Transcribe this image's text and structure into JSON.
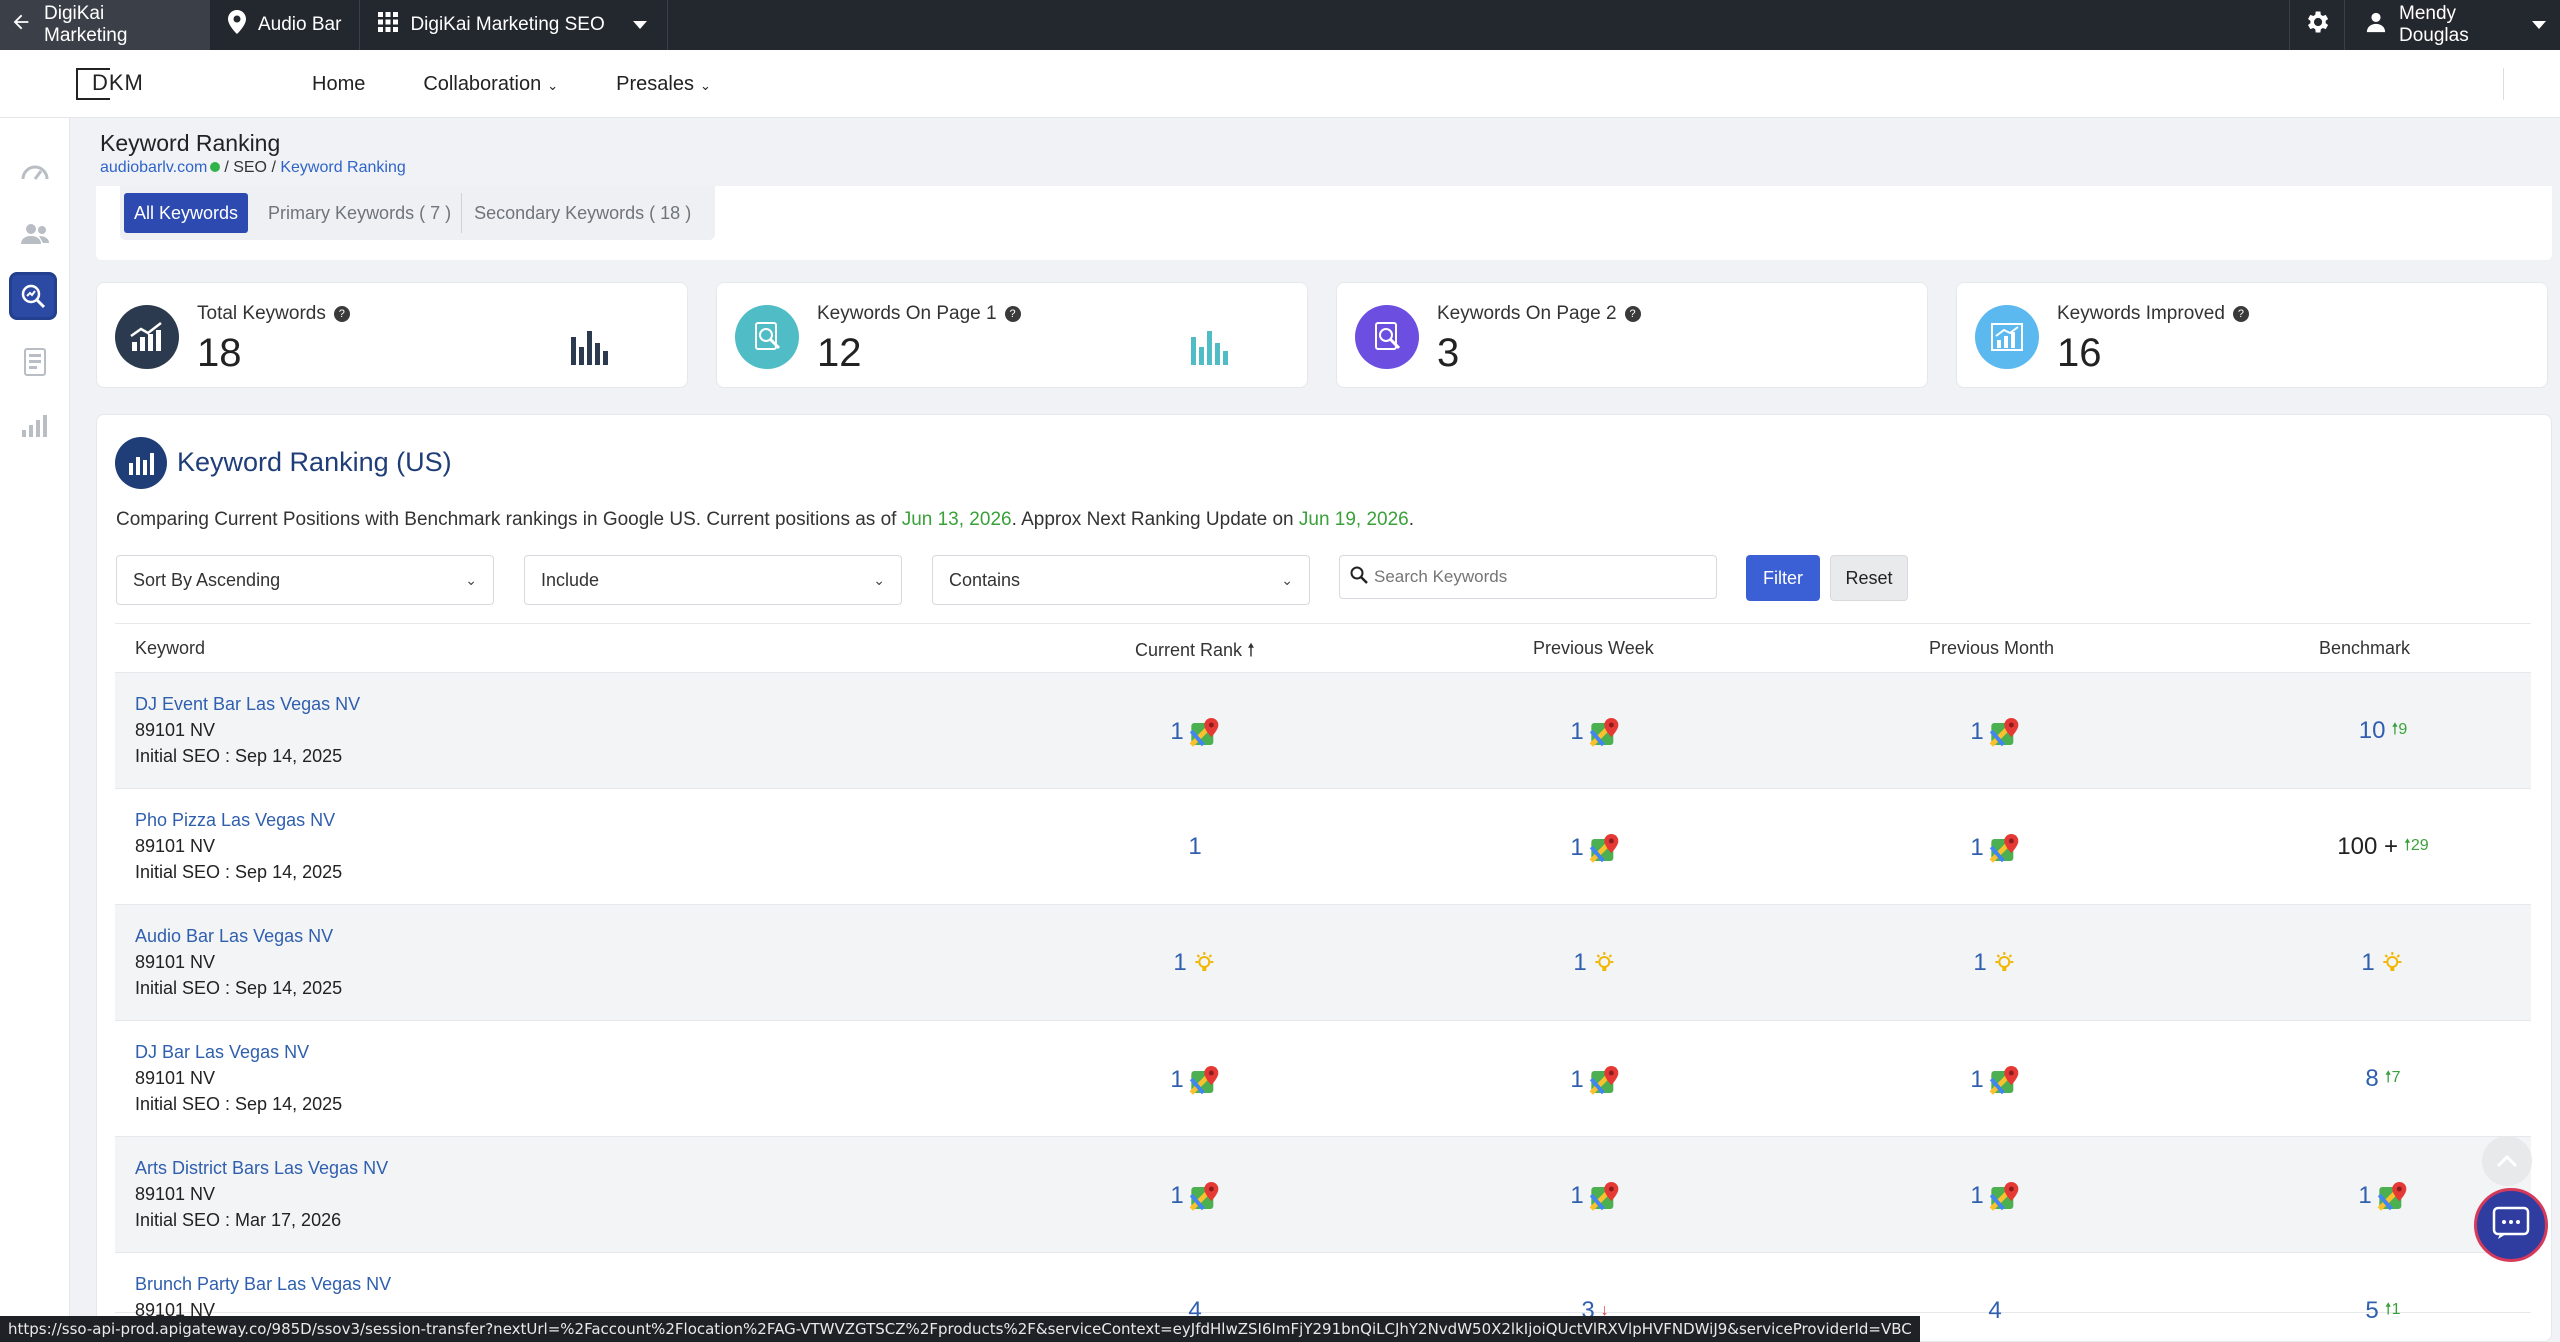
{
  "topbar": {
    "back_label": "DigiKai Marketing",
    "location": "Audio Bar",
    "app_switcher": "DigiKai Marketing SEO",
    "user_name": "Mendy Douglas"
  },
  "navbar": {
    "logo": "DKM",
    "links": [
      "Home",
      "Collaboration",
      "Presales"
    ]
  },
  "page": {
    "title": "Keyword Ranking",
    "breadcrumb": {
      "site": "audiobarlv.com",
      "section": "SEO",
      "current": "Keyword Ranking"
    }
  },
  "tabs": [
    "All Keywords",
    "Primary Keywords ( 7 )",
    "Secondary Keywords ( 18 )"
  ],
  "stats": [
    {
      "label": "Total Keywords",
      "value": "18",
      "color": "#2b3a4e"
    },
    {
      "label": "Keywords On Page 1",
      "value": "12",
      "color": "#4fbcc6"
    },
    {
      "label": "Keywords On Page 2",
      "value": "3",
      "color": "#6c4ee0"
    },
    {
      "label": "Keywords Improved",
      "value": "16",
      "color": "#5bb9f0"
    }
  ],
  "ranking": {
    "title": "Keyword Ranking (US)",
    "desc_prefix": "Comparing Current Positions with Benchmark rankings in Google US. Current positions as of ",
    "current_date": "Jun 13, 2026",
    "desc_mid": ". Approx Next Ranking Update on ",
    "next_date": "Jun 19, 2026",
    "desc_end": ".",
    "sort_select": "Sort By Ascending",
    "include_select": "Include",
    "contains_select": "Contains",
    "search_placeholder": "Search Keywords",
    "filter_label": "Filter",
    "reset_label": "Reset",
    "columns": [
      "Keyword",
      "Current Rank",
      "Previous Week",
      "Previous Month",
      "Benchmark"
    ],
    "sort_arrow": "🠕"
  },
  "rows": [
    {
      "keyword": "DJ Event Bar Las Vegas NV",
      "zip": "89101 NV",
      "initial": "Initial SEO : Sep 14, 2025",
      "current": "1",
      "current_icon": "map",
      "week": "1",
      "week_icon": "map",
      "month": "1",
      "month_icon": "map",
      "bench": "10",
      "bench_icon": "",
      "bench_change": "9",
      "bench_dir": "up",
      "bench_dark": false
    },
    {
      "keyword": "Pho Pizza Las Vegas NV",
      "zip": "89101 NV",
      "initial": "Initial SEO : Sep 14, 2025",
      "current": "1",
      "current_icon": "",
      "week": "1",
      "week_icon": "map",
      "month": "1",
      "month_icon": "map",
      "bench": "100 +",
      "bench_icon": "",
      "bench_change": "29",
      "bench_dir": "up",
      "bench_dark": true
    },
    {
      "keyword": "Audio Bar Las Vegas NV",
      "zip": "89101 NV",
      "initial": "Initial SEO : Sep 14, 2025",
      "current": "1",
      "current_icon": "bulb",
      "week": "1",
      "week_icon": "bulb",
      "month": "1",
      "month_icon": "bulb",
      "bench": "1",
      "bench_icon": "bulb",
      "bench_change": "",
      "bench_dir": "",
      "bench_dark": false
    },
    {
      "keyword": "DJ Bar Las Vegas NV",
      "zip": "89101 NV",
      "initial": "Initial SEO : Sep 14, 2025",
      "current": "1",
      "current_icon": "map",
      "week": "1",
      "week_icon": "map",
      "month": "1",
      "month_icon": "map",
      "bench": "8",
      "bench_icon": "",
      "bench_change": "7",
      "bench_dir": "up",
      "bench_dark": false
    },
    {
      "keyword": "Arts District Bars Las Vegas NV",
      "zip": "89101 NV",
      "initial": "Initial SEO : Mar 17, 2026",
      "current": "1",
      "current_icon": "map",
      "week": "1",
      "week_icon": "map",
      "month": "1",
      "month_icon": "map",
      "bench": "1",
      "bench_icon": "map",
      "bench_change": "",
      "bench_dir": "",
      "bench_dark": false
    },
    {
      "keyword": "Brunch Party Bar Las Vegas NV",
      "zip": "89101 NV",
      "initial": "",
      "current": "4",
      "current_icon": "",
      "week": "3",
      "week_icon": "",
      "week_change": "",
      "week_dir": "down",
      "month": "4",
      "month_icon": "",
      "bench": "5",
      "bench_icon": "",
      "bench_change": "1",
      "bench_dir": "up",
      "bench_dark": false
    }
  ],
  "status_url": "https://sso-api-prod.apigateway.co/985D/ssov3/session-transfer?nextUrl=%2Faccount%2Flocation%2FAG-VTWVZGTSCZ%2Fproducts%2F&serviceContext=eyJfdHlwZSI6ImFjY291bnQiLCJhY2NvdW50X2lkIjoiQUctVlRXVlpHVFNDWiJ9&serviceProviderId=VBC"
}
